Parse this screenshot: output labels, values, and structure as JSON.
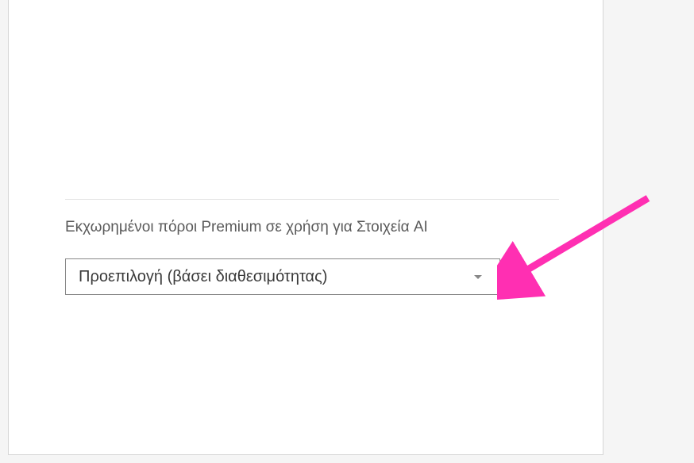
{
  "field": {
    "label": "Εκχωρημένοι πόροι Premium σε χρήση για Στοιχεία AI",
    "selected_value": "Προεπιλογή (βάσει διαθεσιμότητας)"
  },
  "annotation": {
    "arrow_color": "#ff2fb2"
  }
}
